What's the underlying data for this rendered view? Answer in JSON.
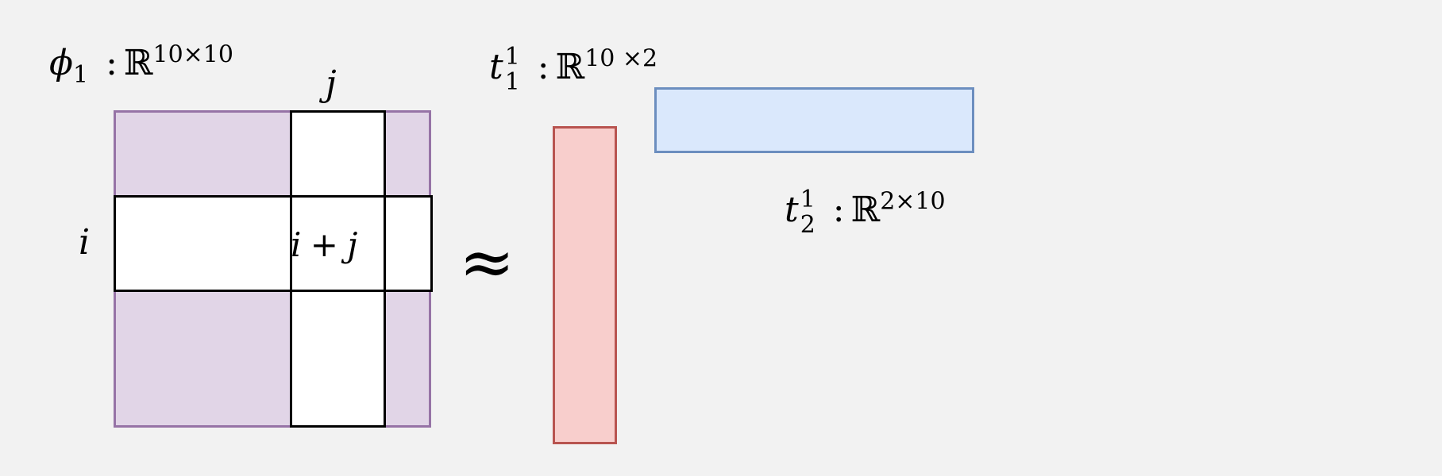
{
  "phi_label": {
    "symbol": "ϕ",
    "sub": "1",
    "colon": ":",
    "field": "ℝ",
    "dims": "10×10"
  },
  "col_index": "j",
  "row_index": "i",
  "cell_label": "i + j",
  "approx": "≈",
  "t1_label": {
    "symbol": "t",
    "sup": "1",
    "sub": "1",
    "colon": ":",
    "field": "ℝ",
    "dims": "10 ×2"
  },
  "t2_label": {
    "symbol": "t",
    "sup": "1",
    "sub": "2",
    "colon": ":",
    "field": "ℝ",
    "dims": "2×10"
  },
  "colors": {
    "matrix_fill": "#e1d5e7",
    "matrix_stroke": "#9673a6",
    "t1_fill": "#f8cecc",
    "t1_stroke": "#b85450",
    "t2_fill": "#dae8fc",
    "t2_stroke": "#6c8ebf",
    "background": "#f2f2f2"
  }
}
